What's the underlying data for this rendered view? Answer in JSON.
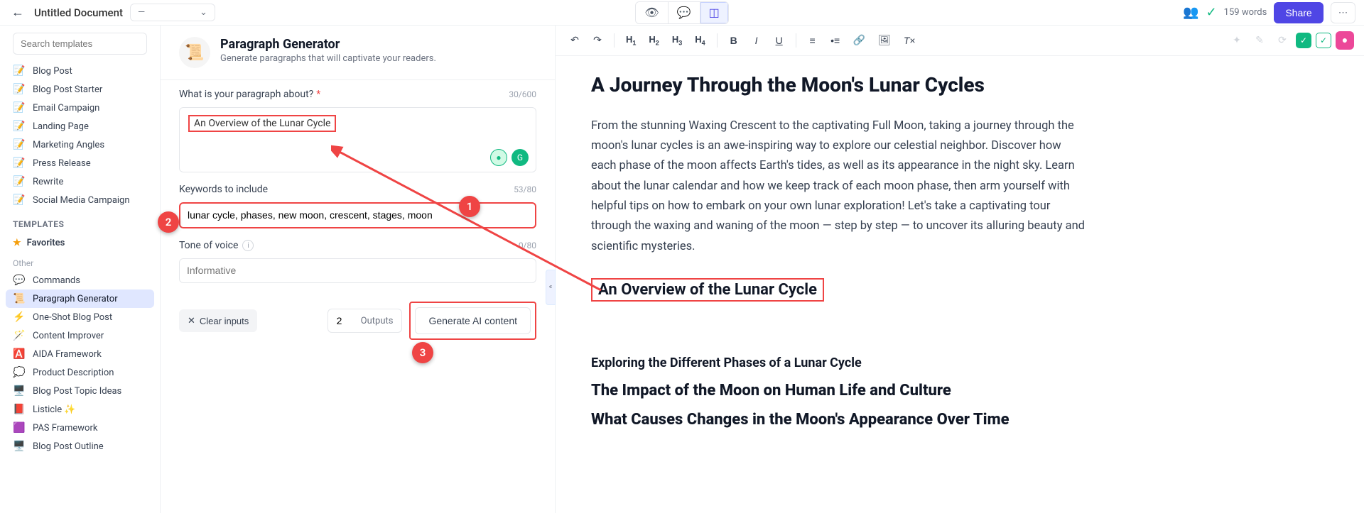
{
  "topbar": {
    "doc_title": "Untitled Document",
    "status_text": "—",
    "word_count": "159 words",
    "share_label": "Share"
  },
  "sidebar": {
    "search_placeholder": "Search templates",
    "recent": [
      {
        "icon": "📝",
        "label": "Blog Post"
      },
      {
        "icon": "📝",
        "label": "Blog Post Starter"
      },
      {
        "icon": "📝",
        "label": "Email Campaign"
      },
      {
        "icon": "📝",
        "label": "Landing Page"
      },
      {
        "icon": "📝",
        "label": "Marketing Angles"
      },
      {
        "icon": "📝",
        "label": "Press Release"
      },
      {
        "icon": "📝",
        "label": "Rewrite"
      },
      {
        "icon": "📝",
        "label": "Social Media Campaign"
      }
    ],
    "templates_header": "TEMPLATES",
    "favorites_label": "Favorites",
    "other_header": "Other",
    "other": [
      {
        "icon": "💬",
        "label": "Commands",
        "active": false
      },
      {
        "icon": "📜",
        "label": "Paragraph Generator",
        "active": true
      },
      {
        "icon": "⚡",
        "label": "One-Shot Blog Post",
        "active": false
      },
      {
        "icon": "🪄",
        "label": "Content Improver",
        "active": false
      },
      {
        "icon": "🅰️",
        "label": "AIDA Framework",
        "active": false
      },
      {
        "icon": "💭",
        "label": "Product Description",
        "active": false
      },
      {
        "icon": "🖥️",
        "label": "Blog Post Topic Ideas",
        "active": false
      },
      {
        "icon": "📕",
        "label": "Listicle ✨",
        "active": false
      },
      {
        "icon": "🟪",
        "label": "PAS Framework",
        "active": false
      },
      {
        "icon": "🖥️",
        "label": "Blog Post Outline",
        "active": false
      }
    ]
  },
  "generator": {
    "title": "Paragraph Generator",
    "subtitle": "Generate paragraphs that will captivate your readers.",
    "about_label": "What is your paragraph about?",
    "about_counter": "30/600",
    "about_value": "An Overview of the Lunar Cycle",
    "keywords_label": "Keywords to include",
    "keywords_counter": "53/80",
    "keywords_value": "lunar cycle, phases, new moon, crescent, stages, moon",
    "tone_label": "Tone of voice",
    "tone_counter": "0/80",
    "tone_placeholder": "Informative",
    "clear_label": "Clear inputs",
    "outputs_value": "2",
    "outputs_label": "Outputs",
    "generate_label": "Generate AI content"
  },
  "editor": {
    "h1": "A Journey Through the Moon's Lunar Cycles",
    "para": "From the stunning Waxing Crescent to the captivating Full Moon, taking a journey through the moon's lunar cycles is an awe-inspiring way to explore our celestial neighbor. Discover how each phase of the moon affects Earth's tides, as well as its appearance in the night sky. Learn about the lunar calendar and how we keep track of each moon phase, then arm yourself with helpful tips on how to embark on your own lunar exploration! Let's take a captivating tour through the waxing and waning of the moon — step by step — to uncover its alluring beauty and scientific mysteries.",
    "h2": "An Overview of the Lunar Cycle",
    "h3a": "Exploring the Different Phases of a Lunar Cycle",
    "h2b": "The Impact of the Moon on Human Life and Culture",
    "h2c": "What Causes Changes in the Moon's Appearance Over Time"
  },
  "annotations": {
    "b1": "1",
    "b2": "2",
    "b3": "3"
  }
}
